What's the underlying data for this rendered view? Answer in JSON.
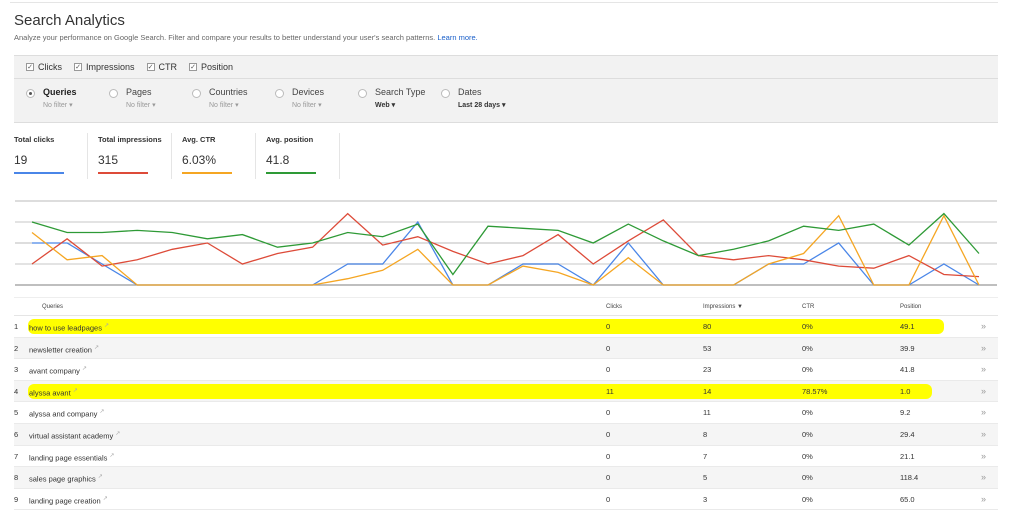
{
  "header": {
    "title": "Search Analytics",
    "subtitle": "Analyze your performance on Google Search. Filter and compare your results to better understand your user's search patterns.",
    "learn_more": "Learn more."
  },
  "metric_toggles": [
    {
      "label": "Clicks",
      "checked": true
    },
    {
      "label": "Impressions",
      "checked": true
    },
    {
      "label": "CTR",
      "checked": true
    },
    {
      "label": "Position",
      "checked": true
    }
  ],
  "filters": [
    {
      "label": "Queries",
      "value": "No filter",
      "selected": true
    },
    {
      "label": "Pages",
      "value": "No filter",
      "selected": false
    },
    {
      "label": "Countries",
      "value": "No filter",
      "selected": false
    },
    {
      "label": "Devices",
      "value": "No filter",
      "selected": false
    },
    {
      "label": "Search Type",
      "value": "Web",
      "selected": false
    },
    {
      "label": "Dates",
      "value": "Last 28 days",
      "selected": false
    }
  ],
  "summary": [
    {
      "label": "Total clicks",
      "value": "19",
      "color": "#4a86e8"
    },
    {
      "label": "Total impressions",
      "value": "315",
      "color": "#dd4b39"
    },
    {
      "label": "Avg. CTR",
      "value": "6.03%",
      "color": "#f5a623"
    },
    {
      "label": "Avg. position",
      "value": "41.8",
      "color": "#2e9a36"
    }
  ],
  "chart_data": {
    "type": "line",
    "title": "",
    "xlabel": "",
    "ylabel": "",
    "x": [
      1,
      2,
      3,
      4,
      5,
      6,
      7,
      8,
      9,
      10,
      11,
      12,
      13,
      14,
      15,
      16,
      17,
      18,
      19,
      20,
      21,
      22,
      23,
      24,
      25,
      26,
      27,
      28
    ],
    "ylim": [
      0,
      4
    ],
    "grid": true,
    "note": "values in relative gridline units (axis unlabeled in screenshot)",
    "series": [
      {
        "name": "Clicks",
        "color": "#4a86e8",
        "values": [
          2,
          2,
          1,
          0,
          0,
          0,
          0,
          0,
          0,
          1,
          1,
          3,
          0,
          0,
          1,
          1,
          0,
          2,
          0,
          0,
          0,
          1,
          1,
          2,
          0,
          0,
          1,
          0
        ]
      },
      {
        "name": "Impressions",
        "color": "#dd4b39",
        "values": [
          1,
          2.2,
          0.9,
          1.2,
          1.7,
          2,
          1,
          1.5,
          1.8,
          3.4,
          1.9,
          2.3,
          1.6,
          1,
          1.4,
          2.4,
          1,
          2.1,
          3.1,
          1.4,
          1.2,
          1.4,
          1.2,
          0.9,
          0.8,
          1.4,
          0.5,
          0.4
        ]
      },
      {
        "name": "CTR",
        "color": "#f5a623",
        "values": [
          2.5,
          1.2,
          1.4,
          0,
          0,
          0,
          0,
          0,
          0,
          0.3,
          0.7,
          1.7,
          0,
          0,
          0.9,
          0.6,
          0,
          1.3,
          0,
          0,
          0,
          1,
          1.5,
          3.3,
          0,
          0,
          3.3,
          0
        ]
      },
      {
        "name": "Position",
        "color": "#2e9a36",
        "values": [
          3,
          2.5,
          2.5,
          2.6,
          2.5,
          2.2,
          2.4,
          1.8,
          2,
          2.5,
          2.3,
          2.9,
          0.5,
          2.8,
          2.7,
          2.6,
          2,
          2.9,
          2.1,
          1.4,
          1.7,
          2.1,
          2.8,
          2.6,
          2.9,
          1.9,
          3.4,
          1.5
        ]
      }
    ]
  },
  "table": {
    "columns": [
      "",
      "Queries",
      "Clicks",
      "Impressions ▼",
      "CTR",
      "Position",
      ""
    ],
    "rows": [
      {
        "num": "1",
        "query": "how to use leadpages",
        "clicks": "0",
        "impressions": "80",
        "ctr": "0%",
        "position": "49.1",
        "highlighted": true
      },
      {
        "num": "2",
        "query": "newsletter creation",
        "clicks": "0",
        "impressions": "53",
        "ctr": "0%",
        "position": "39.9",
        "highlighted": false
      },
      {
        "num": "3",
        "query": "avant company",
        "clicks": "0",
        "impressions": "23",
        "ctr": "0%",
        "position": "41.8",
        "highlighted": false
      },
      {
        "num": "4",
        "query": "alyssa avant",
        "clicks": "11",
        "impressions": "14",
        "ctr": "78.57%",
        "position": "1.0",
        "highlighted": true
      },
      {
        "num": "5",
        "query": "alyssa and company",
        "clicks": "0",
        "impressions": "11",
        "ctr": "0%",
        "position": "9.2",
        "highlighted": false
      },
      {
        "num": "6",
        "query": "virtual assistant academy",
        "clicks": "0",
        "impressions": "8",
        "ctr": "0%",
        "position": "29.4",
        "highlighted": false
      },
      {
        "num": "7",
        "query": "landing page essentials",
        "clicks": "0",
        "impressions": "7",
        "ctr": "0%",
        "position": "21.1",
        "highlighted": false
      },
      {
        "num": "8",
        "query": "sales page graphics",
        "clicks": "0",
        "impressions": "5",
        "ctr": "0%",
        "position": "118.4",
        "highlighted": false
      },
      {
        "num": "9",
        "query": "landing page creation",
        "clicks": "0",
        "impressions": "3",
        "ctr": "0%",
        "position": "65.0",
        "highlighted": false
      }
    ],
    "row_action": "»",
    "external_link_icon": "↗"
  },
  "highlight_color": "#ffff00"
}
